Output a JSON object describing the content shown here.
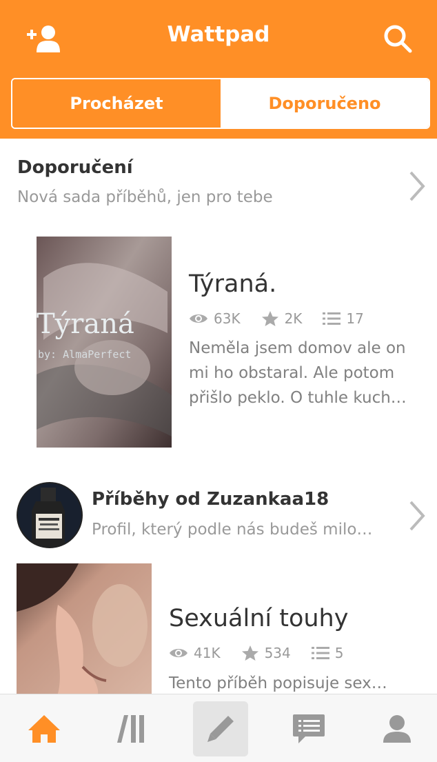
{
  "header": {
    "title": "Wattpad",
    "left_icon": "add-user-icon",
    "right_icon": "search-icon"
  },
  "tabs": [
    {
      "label": "Procházet",
      "active": true
    },
    {
      "label": "Doporučeno",
      "active": false
    }
  ],
  "recommended": {
    "title": "Doporučení",
    "subtitle": "Nová sada příběhů, jen pro tebe",
    "story": {
      "title": "Týraná.",
      "cover_text": "Týraná",
      "cover_author": "by: AlmaPerfect",
      "reads": "63K",
      "votes": "2K",
      "parts": "17",
      "description_lines": [
        "Neměla jsem domov ale on",
        "mi ho obstaral. Ale potom",
        "přišlo peklo. O tuhle kuch…"
      ]
    }
  },
  "profile_section": {
    "title": "Příběhy od Zuzankaa18",
    "subtitle": "Profil, který podle nás budeš milo…",
    "story": {
      "title": "Sexuální touhy",
      "reads": "41K",
      "votes": "534",
      "parts": "5",
      "description_lines": [
        "Tento příběh popisuje sex…"
      ]
    }
  },
  "tabbar": [
    {
      "name": "home-icon",
      "active": true
    },
    {
      "name": "library-icon",
      "active": false
    },
    {
      "name": "write-icon",
      "active": false
    },
    {
      "name": "messages-icon",
      "active": false
    },
    {
      "name": "profile-icon",
      "active": false
    }
  ],
  "colors": {
    "brand": "#ff8f26",
    "text": "#333333",
    "muted": "#999999"
  }
}
